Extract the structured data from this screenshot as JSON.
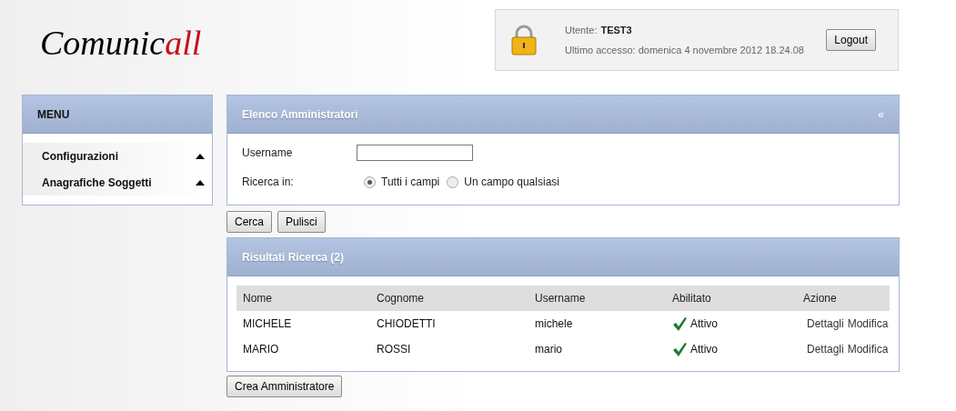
{
  "logo": {
    "dark": "Comunic",
    "accent": "all"
  },
  "user_box": {
    "user_label": "Utente:",
    "user": "TEST3",
    "last_access": "Ultimo accesso: domenica 4 novembre 2012 18.24.08",
    "logout": "Logout"
  },
  "menu": {
    "title": "MENU",
    "items": [
      {
        "label": "Configurazioni",
        "expanded": false
      },
      {
        "label": "Anagrafiche Soggetti",
        "expanded": false
      }
    ]
  },
  "search_panel": {
    "title": "Elenco Amministratori",
    "collapse": "«",
    "username_label": "Username",
    "scope_label": "Ricerca in:",
    "options": [
      {
        "label": "Tutti i campi",
        "selected": true
      },
      {
        "label": "Un campo qualsiasi",
        "selected": false
      }
    ]
  },
  "buttons": [
    "Cerca",
    "Pulisci"
  ],
  "results": {
    "title": "Risultati Ricerca (2)",
    "columns": [
      "Nome",
      "Cognome",
      "Username",
      "Abilitato",
      "Azione"
    ],
    "rows": [
      {
        "nome": "MICHELE",
        "cognome": "CHIODETTI",
        "username": "michele",
        "enabled": true,
        "status": "Attivo",
        "actions": [
          "Dettagli",
          "Modifica"
        ]
      },
      {
        "nome": "MARIO",
        "cognome": "ROSSI",
        "username": "mario",
        "enabled": true,
        "status": "Attivo",
        "actions": [
          "Dettagli",
          "Modifica"
        ]
      }
    ]
  },
  "create_button": "Crea Amministratore"
}
